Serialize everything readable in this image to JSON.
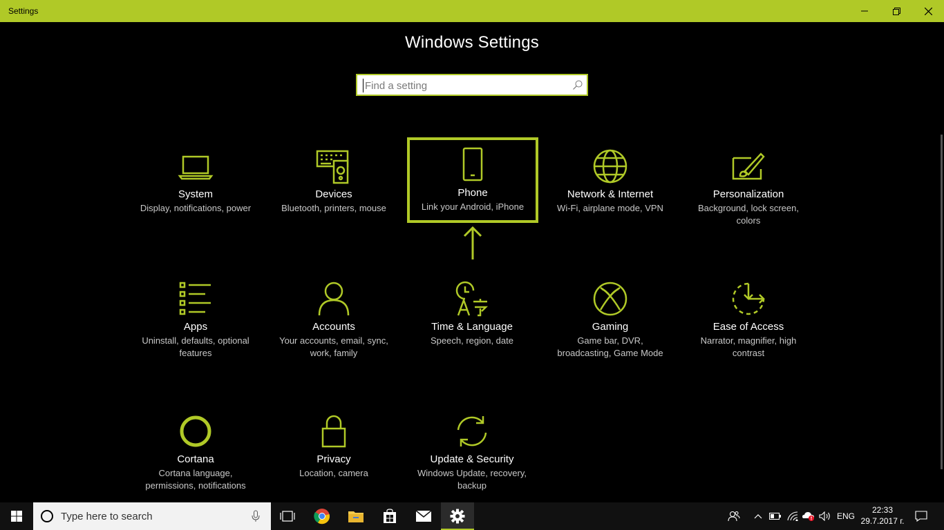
{
  "window": {
    "title": "Settings"
  },
  "main": {
    "heading": "Windows Settings",
    "search_placeholder": "Find a setting"
  },
  "tiles": [
    {
      "title": "System",
      "desc": "Display, notifications, power",
      "icon": "laptop-icon"
    },
    {
      "title": "Devices",
      "desc": "Bluetooth, printers, mouse",
      "icon": "devices-icon"
    },
    {
      "title": "Phone",
      "desc": "Link your Android, iPhone",
      "icon": "phone-icon",
      "selected": true
    },
    {
      "title": "Network & Internet",
      "desc": "Wi-Fi, airplane mode, VPN",
      "icon": "globe-icon"
    },
    {
      "title": "Personalization",
      "desc": "Background, lock screen, colors",
      "icon": "paintbrush-icon"
    },
    {
      "title": "Apps",
      "desc": "Uninstall, defaults, optional features",
      "icon": "apps-list-icon"
    },
    {
      "title": "Accounts",
      "desc": "Your accounts, email, sync, work, family",
      "icon": "person-icon"
    },
    {
      "title": "Time & Language",
      "desc": "Speech, region, date",
      "icon": "time-language-icon"
    },
    {
      "title": "Gaming",
      "desc": "Game bar, DVR, broadcasting, Game Mode",
      "icon": "xbox-icon"
    },
    {
      "title": "Ease of Access",
      "desc": "Narrator, magnifier, high contrast",
      "icon": "ease-of-access-icon"
    },
    {
      "title": "Cortana",
      "desc": "Cortana language, permissions, notifications",
      "icon": "cortana-icon"
    },
    {
      "title": "Privacy",
      "desc": "Location, camera",
      "icon": "lock-icon"
    },
    {
      "title": "Update & Security",
      "desc": "Windows Update, recovery, backup",
      "icon": "sync-icon"
    }
  ],
  "taskbar": {
    "search_placeholder": "Type here to search",
    "language": "ENG",
    "time": "22:33",
    "date": "29.7.2017 г."
  },
  "colors": {
    "accent": "#b0c927",
    "background": "#000000",
    "taskbar": "#111111"
  }
}
